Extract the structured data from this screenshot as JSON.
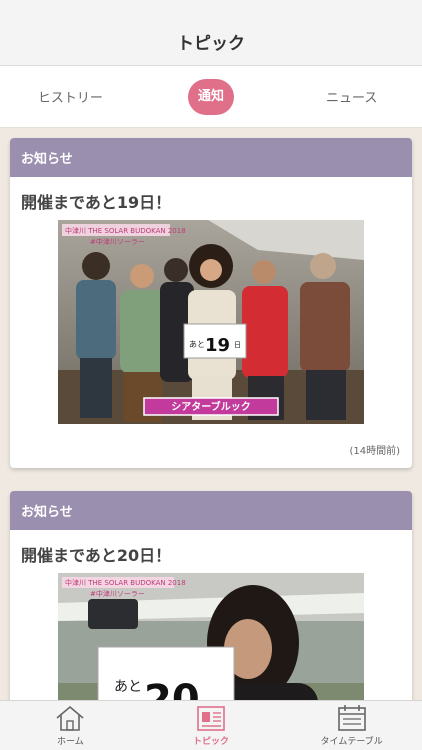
{
  "header": {
    "title": "トピック"
  },
  "tabs": [
    {
      "label": "ヒストリー",
      "active": false
    },
    {
      "label": "通知",
      "active": true
    },
    {
      "label": "ニュース",
      "active": false
    }
  ],
  "cards": [
    {
      "category": "お知らせ",
      "title": "開催まであと19日！",
      "timestamp": "(14時間前)",
      "photo": {
        "banner": "中津川 THE SOLAR BUDOKAN 2018",
        "tag": "#中津川ソーラー",
        "sign_prefix": "あと",
        "sign_number": "19",
        "sign_suffix": "日",
        "caption": "シアターブルック"
      }
    },
    {
      "category": "お知らせ",
      "title": "開催まであと20日！",
      "photo": {
        "banner": "中津川 THE SOLAR BUDOKAN 2018",
        "tag": "#中津川ソーラー",
        "sign_prefix": "あと",
        "sign_number": "20"
      }
    }
  ],
  "bottom_nav": [
    {
      "label": "ホーム",
      "icon": "home-icon",
      "active": false
    },
    {
      "label": "トピック",
      "icon": "topics-icon",
      "active": true
    },
    {
      "label": "タイムテーブル",
      "icon": "timetable-icon",
      "active": false
    }
  ],
  "colors": {
    "accent": "#e0708a",
    "card_header": "#9b8fb0",
    "background": "#efe9e1"
  }
}
